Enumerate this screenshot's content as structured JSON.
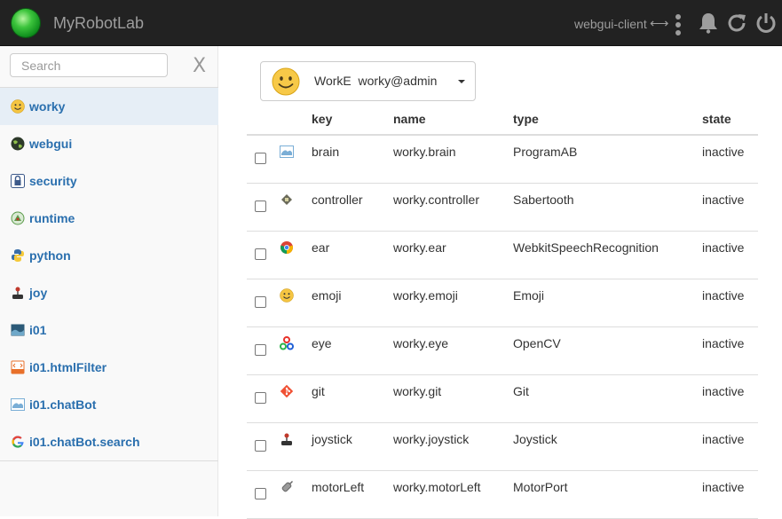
{
  "header": {
    "brand": "MyRobotLab",
    "client_label": "webgui-client",
    "client_arrow": "⟷",
    "icons": [
      "status-orb-icon",
      "more-vertical-icon",
      "bell-icon",
      "refresh-icon",
      "power-icon"
    ]
  },
  "sidebar": {
    "search_placeholder": "Search",
    "close_label": "X",
    "items": [
      {
        "label": "worky",
        "icon": "emoji-icon",
        "active": true
      },
      {
        "label": "webgui",
        "icon": "globe-icon"
      },
      {
        "label": "security",
        "icon": "lock-icon"
      },
      {
        "label": "runtime",
        "icon": "runtime-icon"
      },
      {
        "label": "python",
        "icon": "python-icon"
      },
      {
        "label": "joy",
        "icon": "joystick-icon"
      },
      {
        "label": "i01",
        "icon": "inmoov-icon"
      },
      {
        "label": "i01.htmlFilter",
        "icon": "html-icon"
      },
      {
        "label": "i01.chatBot",
        "icon": "programab-icon"
      },
      {
        "label": "i01.chatBot.search",
        "icon": "google-icon"
      }
    ]
  },
  "selector": {
    "label": "WorkE  worky@admin",
    "icon": "smiley-icon"
  },
  "table": {
    "headers": {
      "key": "key",
      "name": "name",
      "type": "type",
      "state": "state"
    },
    "rows": [
      {
        "key": "brain",
        "name": "worky.brain",
        "type": "ProgramAB",
        "state": "inactive",
        "icon": "programab-icon"
      },
      {
        "key": "controller",
        "name": "worky.controller",
        "type": "Sabertooth",
        "state": "inactive",
        "icon": "motor-controller-icon"
      },
      {
        "key": "ear",
        "name": "worky.ear",
        "type": "WebkitSpeechRecognition",
        "state": "inactive",
        "icon": "chrome-icon"
      },
      {
        "key": "emoji",
        "name": "worky.emoji",
        "type": "Emoji",
        "state": "inactive",
        "icon": "emoji-icon"
      },
      {
        "key": "eye",
        "name": "worky.eye",
        "type": "OpenCV",
        "state": "inactive",
        "icon": "opencv-icon"
      },
      {
        "key": "git",
        "name": "worky.git",
        "type": "Git",
        "state": "inactive",
        "icon": "git-icon"
      },
      {
        "key": "joystick",
        "name": "worky.joystick",
        "type": "Joystick",
        "state": "inactive",
        "icon": "joystick-icon"
      },
      {
        "key": "motorLeft",
        "name": "worky.motorLeft",
        "type": "MotorPort",
        "state": "inactive",
        "icon": "motor-icon"
      }
    ]
  }
}
